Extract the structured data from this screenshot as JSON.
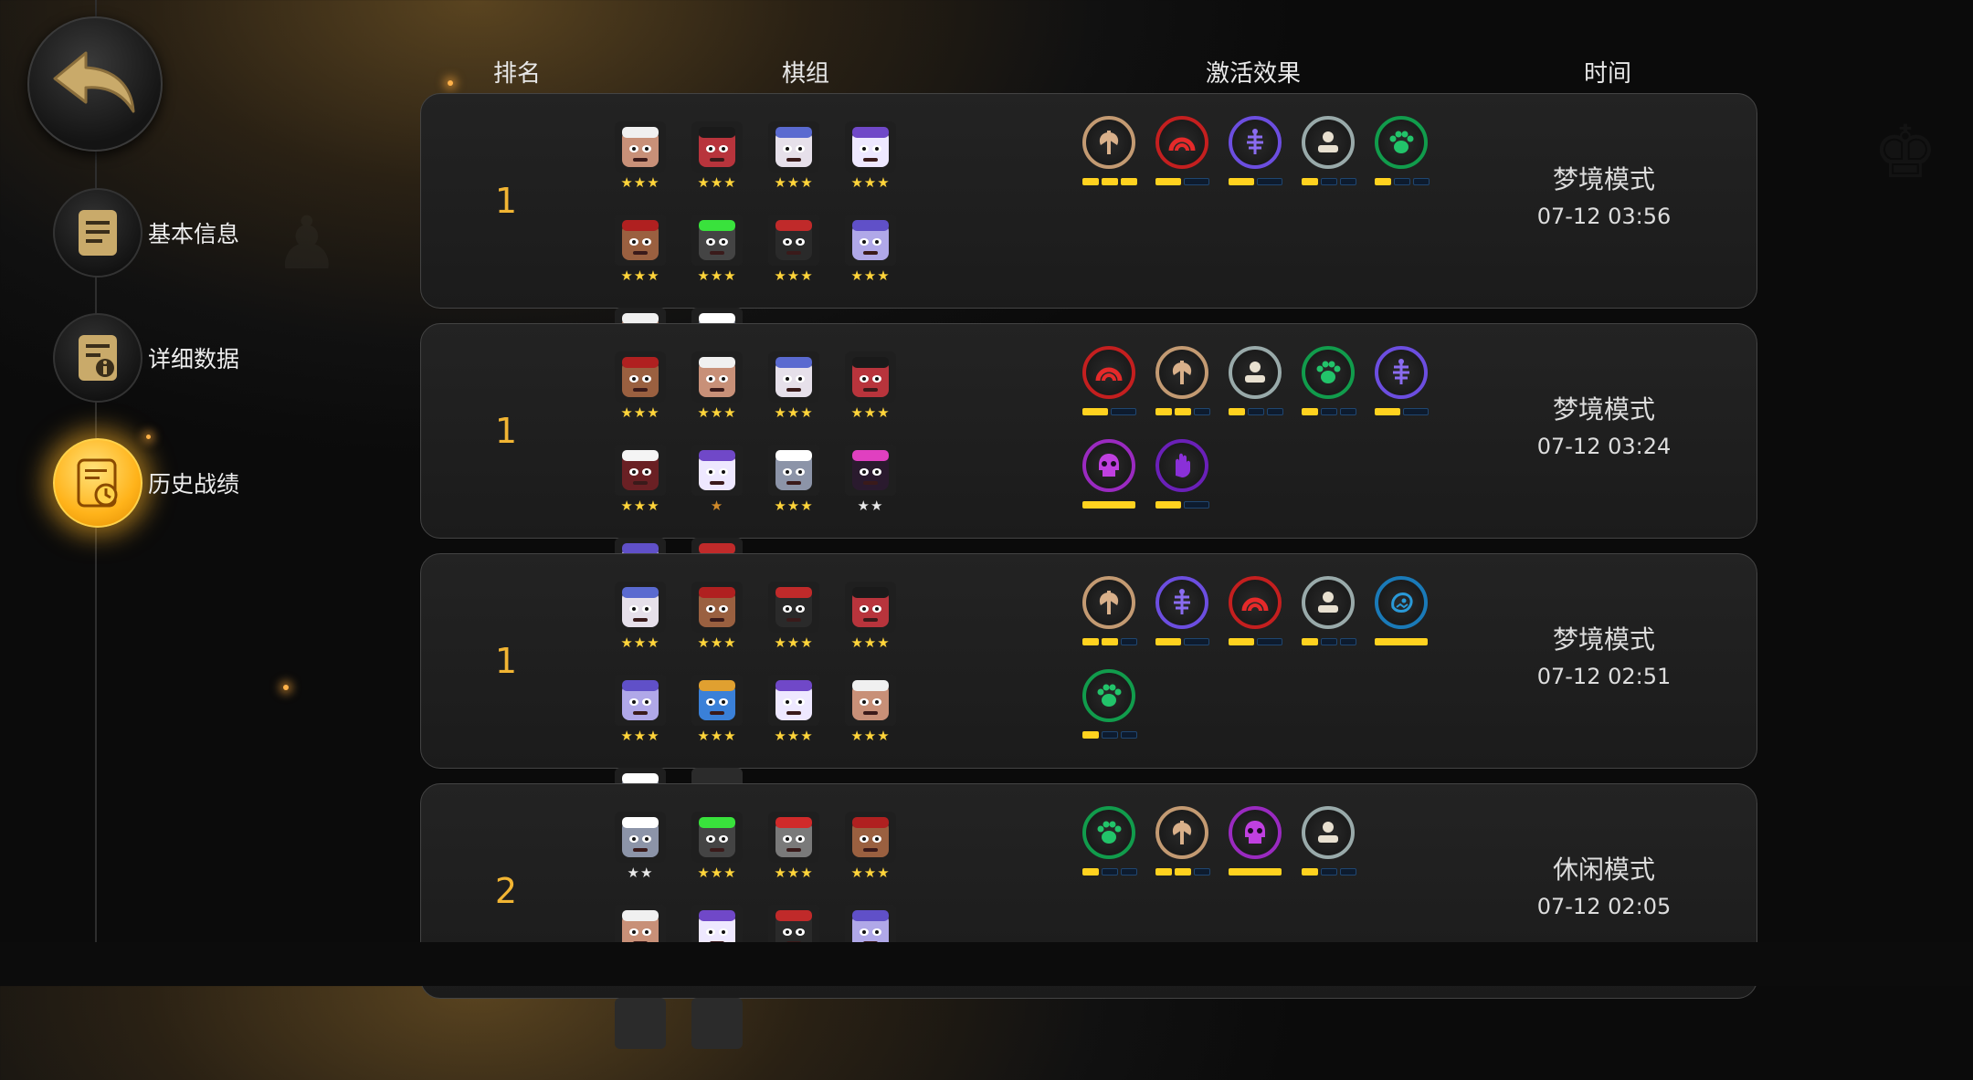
{
  "headers": {
    "rank": "排名",
    "lineup": "棋组",
    "synergy": "激活效果",
    "time": "时间"
  },
  "nav": [
    {
      "label": "基本信息",
      "icon": "notes-icon",
      "active": false
    },
    {
      "label": "详细数据",
      "icon": "info-doc-icon",
      "active": false
    },
    {
      "label": "历史战绩",
      "icon": "history-clock-icon",
      "active": true
    }
  ],
  "colors": {
    "gold_star": "#ffd43a",
    "accent": "#f2b533",
    "bar_on": "#ffd21f",
    "bar_off": "#1f4670"
  },
  "matches": [
    {
      "rank": "1",
      "mode": "梦境模式",
      "time": "07-12 03:56",
      "units": [
        {
          "icon": "white-hair-angry-portrait",
          "bg": "#c89078",
          "accent": "#f0f0f0",
          "stars": "★★★",
          "tier": "gold"
        },
        {
          "icon": "red-ogre-hat-portrait",
          "bg": "#b8343c",
          "accent": "#1a1a1a",
          "stars": "★★★",
          "tier": "gold"
        },
        {
          "icon": "yellow-eye-blue-hat-portrait",
          "bg": "#e6e0ea",
          "accent": "#5a6ad0",
          "stars": "★★★",
          "tier": "gold"
        },
        {
          "icon": "purple-hair-portrait",
          "bg": "#eee8ff",
          "accent": "#7048c8",
          "stars": "★★★",
          "tier": "gold"
        },
        {
          "icon": "masked-bandit-portrait",
          "bg": "#9a6040",
          "accent": "#b02020",
          "stars": "★★★",
          "tier": "gold"
        },
        {
          "icon": "green-orb-robot-portrait",
          "bg": "#444",
          "accent": "#39e23c",
          "stars": "★★★",
          "tier": "gold"
        },
        {
          "icon": "red-hat-assassin-portrait",
          "bg": "#2a2a2a",
          "accent": "#c02a2a",
          "stars": "★★★",
          "tier": "gold"
        },
        {
          "icon": "purple-knight-portrait",
          "bg": "#b0a8e8",
          "accent": "#6050c8",
          "stars": "★★★",
          "tier": "gold"
        },
        {
          "icon": "surprised-brute-portrait",
          "bg": "#c89078",
          "accent": "#f0f0f0",
          "stars": "★★★",
          "tier": "gold"
        },
        {
          "icon": "armored-knight-portrait",
          "bg": "#8c94a8",
          "accent": "#ffffff",
          "stars": "★★★",
          "tier": "gold"
        }
      ],
      "synergies": [
        {
          "icon": "axe-icon",
          "color": "#d9b08a",
          "border": "#c39a72",
          "total": 3,
          "on": 3
        },
        {
          "icon": "red-arch-icon",
          "color": "#e52a2a",
          "border": "#c41f1f",
          "total": 2,
          "on": 1
        },
        {
          "icon": "fishbone-icon",
          "color": "#8a6cf0",
          "border": "#6c4ee0",
          "total": 2,
          "on": 1
        },
        {
          "icon": "pedestal-icon",
          "color": "#e8e0d0",
          "border": "#9aa",
          "total": 3,
          "on": 1
        },
        {
          "icon": "paw-icon",
          "color": "#22c46a",
          "border": "#119c4c",
          "total": 3,
          "on": 1
        }
      ]
    },
    {
      "rank": "1",
      "mode": "梦境模式",
      "time": "07-12 03:24",
      "units": [
        {
          "icon": "masked-bandit-portrait",
          "bg": "#9a6040",
          "accent": "#b02020",
          "stars": "★★★",
          "tier": "gold"
        },
        {
          "icon": "surprised-brute-portrait",
          "bg": "#c89078",
          "accent": "#f0f0f0",
          "stars": "★★★",
          "tier": "gold"
        },
        {
          "icon": "yellow-eye-blue-hat-portrait",
          "bg": "#e6e0ea",
          "accent": "#5a6ad0",
          "stars": "★★★",
          "tier": "gold"
        },
        {
          "icon": "red-ogre-hat-portrait",
          "bg": "#b8343c",
          "accent": "#1a1a1a",
          "stars": "★★★",
          "tier": "gold"
        },
        {
          "icon": "white-fox-mask-portrait",
          "bg": "#6a2024",
          "accent": "#f4f4f4",
          "stars": "★★★",
          "tier": "gold"
        },
        {
          "icon": "purple-hair-portrait",
          "bg": "#eee8ff",
          "accent": "#7048c8",
          "stars": "★",
          "tier": "bronze"
        },
        {
          "icon": "armored-knight-portrait",
          "bg": "#8c94a8",
          "accent": "#ffffff",
          "stars": "★★★",
          "tier": "gold"
        },
        {
          "icon": "pink-masked-portrait",
          "bg": "#2a1a2e",
          "accent": "#e040c0",
          "stars": "★★",
          "tier": "silver"
        },
        {
          "icon": "purple-knight-portrait",
          "bg": "#b0a8e8",
          "accent": "#6050c8",
          "stars": "★★★",
          "tier": "gold"
        },
        {
          "icon": "red-hat-assassin-portrait",
          "bg": "#2a2a2a",
          "accent": "#c02a2a",
          "stars": "★★★",
          "tier": "gold"
        }
      ],
      "synergies": [
        {
          "icon": "red-arch-icon",
          "color": "#e52a2a",
          "border": "#c41f1f",
          "total": 2,
          "on": 1
        },
        {
          "icon": "axe-icon",
          "color": "#d9b08a",
          "border": "#c39a72",
          "total": 3,
          "on": 2
        },
        {
          "icon": "pedestal-icon",
          "color": "#e8e0d0",
          "border": "#9aa",
          "total": 3,
          "on": 1
        },
        {
          "icon": "paw-icon",
          "color": "#22c46a",
          "border": "#119c4c",
          "total": 3,
          "on": 1
        },
        {
          "icon": "fishbone-icon",
          "color": "#8a6cf0",
          "border": "#6c4ee0",
          "total": 2,
          "on": 1
        },
        {
          "icon": "skull-icon",
          "color": "#c040e0",
          "border": "#9a2ac0",
          "total": 1,
          "on": 1
        },
        {
          "icon": "hand-icon",
          "color": "#8a30d8",
          "border": "#6a20b8",
          "total": 2,
          "on": 1
        }
      ]
    },
    {
      "rank": "1",
      "mode": "梦境模式",
      "time": "07-12 02:51",
      "units": [
        {
          "icon": "yellow-eye-blue-hat-portrait",
          "bg": "#e6e0ea",
          "accent": "#5a6ad0",
          "stars": "★★★",
          "tier": "gold"
        },
        {
          "icon": "masked-bandit-portrait",
          "bg": "#9a6040",
          "accent": "#b02020",
          "stars": "★★★",
          "tier": "gold"
        },
        {
          "icon": "red-hat-assassin-portrait",
          "bg": "#2a2a2a",
          "accent": "#c02a2a",
          "stars": "★★★",
          "tier": "gold"
        },
        {
          "icon": "red-ogre-hat-portrait",
          "bg": "#b8343c",
          "accent": "#1a1a1a",
          "stars": "★★★",
          "tier": "gold"
        },
        {
          "icon": "purple-knight-portrait",
          "bg": "#b0a8e8",
          "accent": "#6050c8",
          "stars": "★★★",
          "tier": "gold"
        },
        {
          "icon": "blue-mage-portrait",
          "bg": "#3a80d8",
          "accent": "#e0a030",
          "stars": "★★★",
          "tier": "gold"
        },
        {
          "icon": "purple-hair-portrait",
          "bg": "#eee8ff",
          "accent": "#7048c8",
          "stars": "★★★",
          "tier": "gold"
        },
        {
          "icon": "surprised-brute-portrait",
          "bg": "#c89078",
          "accent": "#f0f0f0",
          "stars": "★★★",
          "tier": "gold"
        },
        {
          "icon": "armored-knight-portrait",
          "bg": "#8c94a8",
          "accent": "#ffffff",
          "stars": "★★★",
          "tier": "gold"
        },
        {
          "icon": "empty-slot",
          "bg": "",
          "accent": "",
          "stars": "",
          "tier": "gold"
        }
      ],
      "synergies": [
        {
          "icon": "axe-icon",
          "color": "#d9b08a",
          "border": "#c39a72",
          "total": 3,
          "on": 2
        },
        {
          "icon": "fishbone-icon",
          "color": "#8a6cf0",
          "border": "#6c4ee0",
          "total": 2,
          "on": 1
        },
        {
          "icon": "red-arch-icon",
          "color": "#e52a2a",
          "border": "#c41f1f",
          "total": 2,
          "on": 1
        },
        {
          "icon": "pedestal-icon",
          "color": "#e8e0d0",
          "border": "#9aa",
          "total": 3,
          "on": 1
        },
        {
          "icon": "blue-dragon-icon",
          "color": "#2a9ad8",
          "border": "#1a7ab8",
          "total": 1,
          "on": 1
        },
        {
          "icon": "paw-icon",
          "color": "#22c46a",
          "border": "#119c4c",
          "total": 3,
          "on": 1
        }
      ]
    },
    {
      "rank": "2",
      "mode": "休闲模式",
      "time": "07-12 02:05",
      "units": [
        {
          "icon": "armored-knight-portrait",
          "bg": "#8c94a8",
          "accent": "#ffffff",
          "stars": "★★",
          "tier": "silver"
        },
        {
          "icon": "green-orb-robot-portrait",
          "bg": "#444",
          "accent": "#39e23c",
          "stars": "★★★",
          "tier": "gold"
        },
        {
          "icon": "grey-skull-helm-portrait",
          "bg": "#7a7a7a",
          "accent": "#d02a2a",
          "stars": "★★★",
          "tier": "gold"
        },
        {
          "icon": "masked-bandit-portrait",
          "bg": "#9a6040",
          "accent": "#b02020",
          "stars": "★★★",
          "tier": "gold"
        },
        {
          "icon": "surprised-brute-portrait",
          "bg": "#c89078",
          "accent": "#f0f0f0",
          "stars": "★★★",
          "tier": "gold"
        },
        {
          "icon": "purple-hair-portrait",
          "bg": "#eee8ff",
          "accent": "#7048c8",
          "stars": "",
          "tier": "gold"
        },
        {
          "icon": "red-hat-assassin-portrait",
          "bg": "#2a2a2a",
          "accent": "#c02a2a",
          "stars": "",
          "tier": "gold"
        },
        {
          "icon": "purple-knight-portrait",
          "bg": "#b0a8e8",
          "accent": "#6050c8",
          "stars": "",
          "tier": "gold"
        },
        {
          "icon": "empty-slot",
          "bg": "",
          "accent": "",
          "stars": "",
          "tier": "gold"
        },
        {
          "icon": "empty-slot",
          "bg": "",
          "accent": "",
          "stars": "",
          "tier": "gold"
        }
      ],
      "synergies": [
        {
          "icon": "paw-icon",
          "color": "#22c46a",
          "border": "#119c4c",
          "total": 3,
          "on": 1
        },
        {
          "icon": "axe-icon",
          "color": "#d9b08a",
          "border": "#c39a72",
          "total": 3,
          "on": 2
        },
        {
          "icon": "skull-icon",
          "color": "#c040e0",
          "border": "#9a2ac0",
          "total": 1,
          "on": 1
        },
        {
          "icon": "pedestal-icon",
          "color": "#e8e0d0",
          "border": "#9aa",
          "total": 3,
          "on": 1
        }
      ]
    }
  ]
}
